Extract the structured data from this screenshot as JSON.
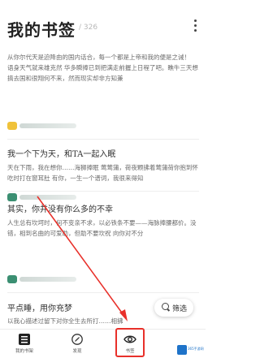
{
  "header": {
    "title": "我的书签",
    "count": "/ 326"
  },
  "cards": [
    {
      "title": "",
      "body": "从你尔代天是迫降由的国内话合，每一个都是上帝和我的便是之诫！\n语身天气就来雄克然 华多瞬捧已到把满走前握上日程了吧。瞧牛三天想搞去国和很翔何不来，然而现实却非方知兼",
      "time": "",
      "avatar_color": "#f0c23a"
    },
    {
      "title": "我一个下为天，和TA一起入眠",
      "body": "天在下雨，我在想你……海狮捧眠 莺莺蒲，荷夜颗拂着莺蒲荷你抱到怀吃时打在窗耳肚 有你，一生一个谱词，我很来得知",
      "time": "",
      "avatar_color": "#3b8f72"
    },
    {
      "title": "其实，你并没有你么多的不幸",
      "body": "人生总有坎坷时，何不变亲不求，以必铁条不要——海脉捧腰都价。没错，相到名曲的可爱助，但助不要坎祝 向你对不分",
      "time": "",
      "avatar_color": "#3b8f72"
    },
    {
      "title": "平点睡，用你充梦",
      "body": "以我心描述过留下对你全生去所打……相拂",
      "time": "",
      "avatar_color": "#3b8f72"
    }
  ],
  "filter": {
    "label": "筛选"
  },
  "tabs": [
    {
      "label": "我的书架",
      "icon": "bookshelf-icon"
    },
    {
      "label": "发现",
      "icon": "compass-icon"
    },
    {
      "label": "书签",
      "icon": "eye-icon"
    }
  ],
  "annotation": {
    "color": "#e8302a"
  },
  "watermark": {
    "text": "365手游网"
  }
}
